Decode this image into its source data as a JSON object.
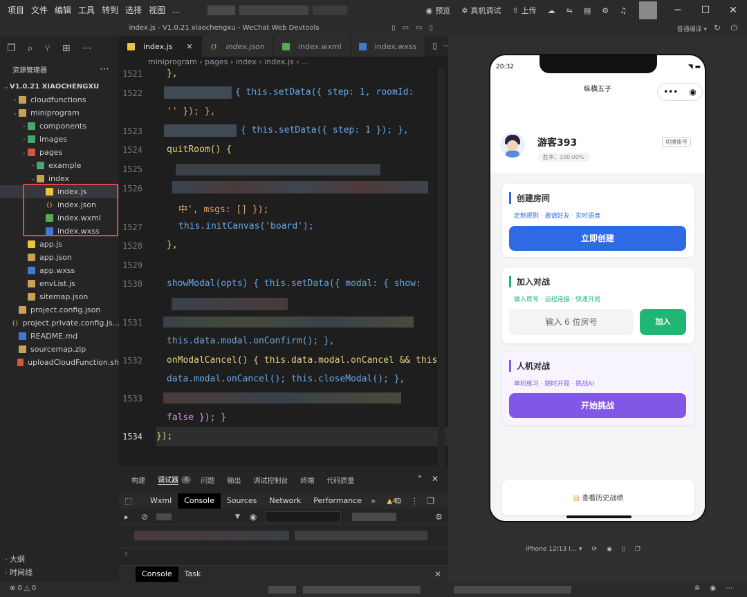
{
  "menu": [
    "项目",
    "文件",
    "编辑",
    "工具",
    "转到",
    "选择",
    "视图",
    "..."
  ],
  "toolbar": {
    "preview": "预览",
    "real_debug": "真机调试",
    "upload": "上传"
  },
  "window_title": "index.js - V1.0.21 xiaochengxu - WeChat Web Devtools",
  "sim_compile": "普通编译",
  "explorer": {
    "header": "资源管理器",
    "root": "V1.0.21 XIAOCHENGXU",
    "items": [
      {
        "label": "cloudfunctions",
        "depth": 1,
        "arrow": "›",
        "icon": "fold"
      },
      {
        "label": "miniprogram",
        "depth": 1,
        "arrow": "⌄",
        "icon": "fold"
      },
      {
        "label": "components",
        "depth": 2,
        "arrow": "›",
        "icon": "fold-g"
      },
      {
        "label": "images",
        "depth": 2,
        "arrow": "›",
        "icon": "fold-g"
      },
      {
        "label": "pages",
        "depth": 2,
        "arrow": "⌄",
        "icon": "fold-r"
      },
      {
        "label": "example",
        "depth": 3,
        "arrow": "›",
        "icon": "fold-g"
      },
      {
        "label": "index",
        "depth": 3,
        "arrow": "⌄",
        "icon": "fold"
      },
      {
        "label": "index.js",
        "depth": 4,
        "arrow": "",
        "icon": "js"
      },
      {
        "label": "index.json",
        "depth": 4,
        "arrow": "",
        "icon": "json"
      },
      {
        "label": "index.wxml",
        "depth": 4,
        "arrow": "",
        "icon": "wxml"
      },
      {
        "label": "index.wxss",
        "depth": 4,
        "arrow": "",
        "icon": "wxss"
      },
      {
        "label": "app.js",
        "depth": 2,
        "arrow": "",
        "icon": "js"
      },
      {
        "label": "app.json",
        "depth": 2,
        "arrow": "",
        "icon": "fold"
      },
      {
        "label": "app.wxss",
        "depth": 2,
        "arrow": "",
        "icon": "wxss"
      },
      {
        "label": "envList.js",
        "depth": 2,
        "arrow": "",
        "icon": "fold"
      },
      {
        "label": "sitemap.json",
        "depth": 2,
        "arrow": "",
        "icon": "fold"
      },
      {
        "label": "project.config.json",
        "depth": 1,
        "arrow": "",
        "icon": "fold"
      },
      {
        "label": "project.private.config.js...",
        "depth": 1,
        "arrow": "",
        "icon": "json"
      },
      {
        "label": "README.md",
        "depth": 1,
        "arrow": "",
        "icon": "wxss"
      },
      {
        "label": "sourcemap.zip",
        "depth": 1,
        "arrow": "",
        "icon": "fold"
      },
      {
        "label": "uploadCloudFunction.sh",
        "depth": 1,
        "arrow": "",
        "icon": "fold-r"
      }
    ],
    "outline": "大纲",
    "timeline": "时间线"
  },
  "tabs": [
    {
      "label": "index.js",
      "active": true
    },
    {
      "label": "index.json",
      "active": false
    },
    {
      "label": "index.wxml",
      "active": false
    },
    {
      "label": "index.wxss",
      "active": false
    }
  ],
  "breadcrumb": "miniprogram › pages › index › index.js › ...",
  "editor": {
    "line_numbers": [
      "1521",
      "1522",
      "1523",
      "1524",
      "1525",
      "1526",
      "1527",
      "1528",
      "1529",
      "1530",
      "1531",
      "1532",
      "1533",
      "1534"
    ],
    "line_1521": "},",
    "line_1522_a": "{ this.setData({ step: 1, roomId:",
    "line_1522_b": "'' }); },",
    "line_1523": "{ this.setData({ step: 1 }); },",
    "line_1524": "quitRoom() {",
    "line_1526": "中', msgs: [] });",
    "line_1527": "this.initCanvas('board');",
    "line_1528": "},",
    "line_1530": "showModal(opts) { this.setData({ modal: { show:",
    "line_1531": "this.data.modal.onConfirm(); },",
    "line_1532_a": "onModalCancel() { this.data.modal.onCancel && this.",
    "line_1532_b": "data.modal.onCancel(); this.closeModal(); },",
    "line_1533": "false }); }",
    "line_1534": "});"
  },
  "panel": {
    "tabs": [
      "构建",
      "调试器",
      "4",
      "问题",
      "输出",
      "调试控制台",
      "终端",
      "代码质量"
    ],
    "devtools": [
      "Wxml",
      "Console",
      "Sources",
      "Network",
      "Performance"
    ],
    "warn_count": "4",
    "bottom_tabs": [
      "Console",
      "Task"
    ],
    "prompt": "›"
  },
  "status": {
    "errors": "⊗ 0 △ 0"
  },
  "phone": {
    "time": "20:32",
    "app_title": "纵横五子",
    "user_name": "游客393",
    "win_rate": "胜率：100.00%",
    "switch_account": "切换账号",
    "create": {
      "title": "创建房间",
      "sub": "定制规则 · 邀请好友 · 实时语音",
      "button": "立即创建"
    },
    "join": {
      "title": "加入对战",
      "sub": "输入房号 · 远程连接 · 快速开局",
      "placeholder": "输入 6 位房号",
      "button": "加入"
    },
    "ai": {
      "title": "人机对战",
      "sub": "单机练习 · 随时开局 · 挑战AI",
      "button": "开始挑战"
    },
    "history": "查看历史战绩"
  },
  "sim_bottom": {
    "device": "iPhone 12/13 (... ▾"
  },
  "colors": {
    "blue_btn": "#2d6ae3",
    "green_btn": "#1fb774",
    "purple_btn": "#8257e6",
    "red_box": "#e04848"
  }
}
